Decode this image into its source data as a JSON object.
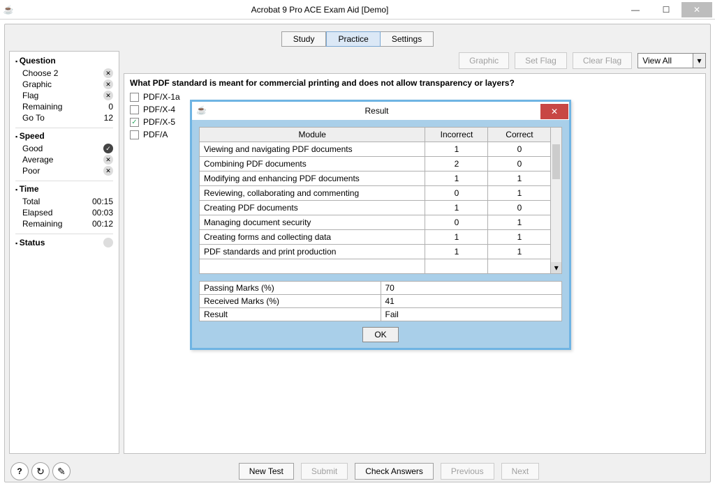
{
  "window": {
    "title": "Acrobat 9 Pro ACE Exam Aid [Demo]"
  },
  "tabs": {
    "study": "Study",
    "practice": "Practice",
    "settings": "Settings",
    "active": "practice"
  },
  "toolbar": {
    "graphic": "Graphic",
    "set_flag": "Set Flag",
    "clear_flag": "Clear Flag",
    "view_all": "View All"
  },
  "sidebar": {
    "question": {
      "header": "Question",
      "choose_label": "Choose 2",
      "choose_mark": "x",
      "graphic_label": "Graphic",
      "graphic_mark": "x",
      "flag_label": "Flag",
      "flag_mark": "x",
      "remaining_label": "Remaining",
      "remaining_val": "0",
      "goto_label": "Go To",
      "goto_val": "12"
    },
    "speed": {
      "header": "Speed",
      "good_label": "Good",
      "good_mark": "check",
      "avg_label": "Average",
      "avg_mark": "x",
      "poor_label": "Poor",
      "poor_mark": "x"
    },
    "time": {
      "header": "Time",
      "total_label": "Total",
      "total_val": "00:15",
      "elapsed_label": "Elapsed",
      "elapsed_val": "00:03",
      "remaining_label": "Remaining",
      "remaining_val": "00:12"
    },
    "status": {
      "header": "Status"
    }
  },
  "question": {
    "text": "What PDF standard is meant for commercial printing and does not allow transparency or layers?",
    "options": [
      {
        "label": "PDF/X-1a",
        "checked": false
      },
      {
        "label": "PDF/X-4",
        "checked": false
      },
      {
        "label": "PDF/X-5",
        "checked": true
      },
      {
        "label": "PDF/A",
        "checked": false
      }
    ]
  },
  "bottom": {
    "new_test": "New Test",
    "submit": "Submit",
    "check": "Check Answers",
    "prev": "Previous",
    "next": "Next"
  },
  "dialog": {
    "title": "Result",
    "headers": {
      "module": "Module",
      "incorrect": "Incorrect",
      "correct": "Correct"
    },
    "rows": [
      {
        "m": "Viewing and navigating PDF documents",
        "i": "1",
        "c": "0"
      },
      {
        "m": "Combining PDF documents",
        "i": "2",
        "c": "0"
      },
      {
        "m": "Modifying and enhancing PDF documents",
        "i": "1",
        "c": "1"
      },
      {
        "m": "Reviewing, collaborating and commenting",
        "i": "0",
        "c": "1"
      },
      {
        "m": "Creating PDF documents",
        "i": "1",
        "c": "0"
      },
      {
        "m": "Managing document security",
        "i": "0",
        "c": "1"
      },
      {
        "m": "Creating forms and collecting data",
        "i": "1",
        "c": "1"
      },
      {
        "m": "PDF standards and print production",
        "i": "1",
        "c": "1"
      }
    ],
    "summary": {
      "passing_label": "Passing Marks (%)",
      "passing_val": "70",
      "received_label": "Received Marks (%)",
      "received_val": "41",
      "result_label": "Result",
      "result_val": "Fail"
    },
    "ok": "OK"
  }
}
